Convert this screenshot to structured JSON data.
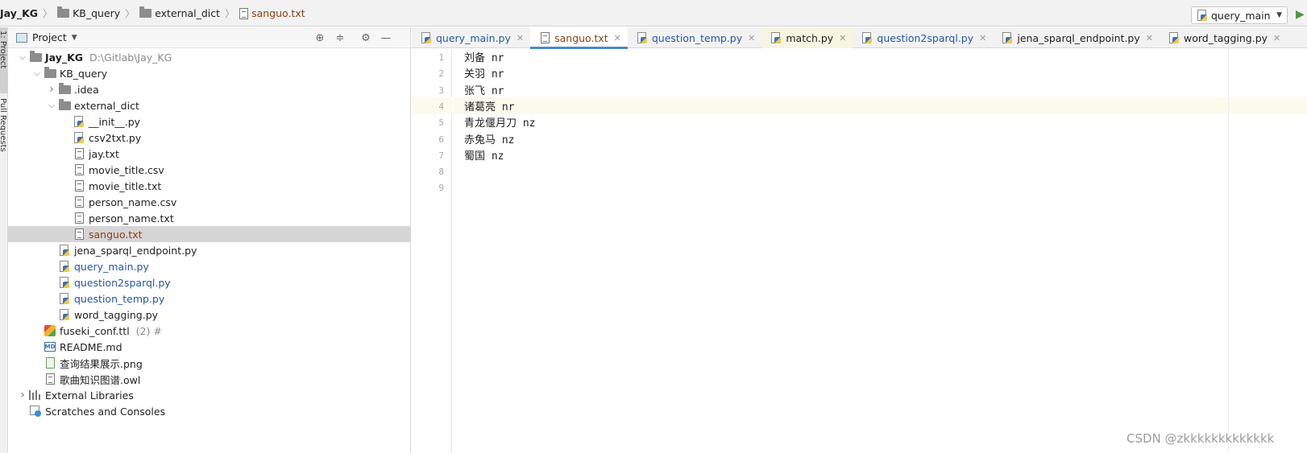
{
  "breadcrumb": [
    "Jay_KG",
    "KB_query",
    "external_dict",
    "sanguo.txt"
  ],
  "run_config": {
    "label": "query_main"
  },
  "side_strip": {
    "project_tab": "1: Project",
    "pull_requests_tab": "Pull Requests"
  },
  "project_panel": {
    "title": "Project",
    "tree": [
      {
        "name": "Jay_KG",
        "extra": "D:\\Gitlab\\Jay_KG",
        "level": 0,
        "arrow": "open",
        "icon": "folder-icon",
        "style": "bold"
      },
      {
        "name": "KB_query",
        "level": 1,
        "arrow": "open",
        "icon": "folder-icon",
        "style": ""
      },
      {
        "name": ".idea",
        "level": 2,
        "arrow": "closed",
        "icon": "folder-icon",
        "style": ""
      },
      {
        "name": "external_dict",
        "level": 2,
        "arrow": "open",
        "icon": "folder-icon",
        "style": ""
      },
      {
        "name": "__init__.py",
        "level": 3,
        "arrow": "none",
        "icon": "python-file-icon",
        "style": ""
      },
      {
        "name": "csv2txt.py",
        "level": 3,
        "arrow": "none",
        "icon": "python-file-icon",
        "style": ""
      },
      {
        "name": "jay.txt",
        "level": 3,
        "arrow": "none",
        "icon": "text-file-icon",
        "style": ""
      },
      {
        "name": "movie_title.csv",
        "level": 3,
        "arrow": "none",
        "icon": "text-file-icon",
        "style": ""
      },
      {
        "name": "movie_title.txt",
        "level": 3,
        "arrow": "none",
        "icon": "text-file-icon",
        "style": ""
      },
      {
        "name": "person_name.csv",
        "level": 3,
        "arrow": "none",
        "icon": "text-file-icon",
        "style": ""
      },
      {
        "name": "person_name.txt",
        "level": 3,
        "arrow": "none",
        "icon": "text-file-icon",
        "style": ""
      },
      {
        "name": "sanguo.txt",
        "level": 3,
        "arrow": "none",
        "icon": "text-file-icon",
        "style": "brown",
        "selected": true
      },
      {
        "name": "jena_sparql_endpoint.py",
        "level": 2,
        "arrow": "none",
        "icon": "python-file-icon",
        "style": ""
      },
      {
        "name": "query_main.py",
        "level": 2,
        "arrow": "none",
        "icon": "python-file-icon",
        "style": "blue"
      },
      {
        "name": "question2sparql.py",
        "level": 2,
        "arrow": "none",
        "icon": "python-file-icon",
        "style": "blue"
      },
      {
        "name": "question_temp.py",
        "level": 2,
        "arrow": "none",
        "icon": "python-file-icon",
        "style": "blue"
      },
      {
        "name": "word_tagging.py",
        "level": 2,
        "arrow": "none",
        "icon": "python-file-icon",
        "style": ""
      },
      {
        "name": "fuseki_conf.ttl",
        "extra": "(2) #",
        "level": 1,
        "arrow": "none",
        "icon": "ttl-file-icon",
        "style": ""
      },
      {
        "name": "README.md",
        "level": 1,
        "arrow": "none",
        "icon": "markdown-file-icon",
        "style": ""
      },
      {
        "name": "查询结果展示.png",
        "level": 1,
        "arrow": "none",
        "icon": "image-file-icon",
        "style": ""
      },
      {
        "name": "歌曲知识图谱.owl",
        "level": 1,
        "arrow": "none",
        "icon": "text-file-icon",
        "style": ""
      },
      {
        "name": "External Libraries",
        "level": 0,
        "arrow": "closed",
        "icon": "library-icon",
        "style": ""
      },
      {
        "name": "Scratches and Consoles",
        "level": 0,
        "arrow": "none",
        "icon": "scratches-icon",
        "style": ""
      }
    ]
  },
  "tabs": [
    {
      "label": "query_main.py",
      "style": "blue",
      "state": ""
    },
    {
      "label": "sanguo.txt",
      "style": "brown",
      "state": "active"
    },
    {
      "label": "question_temp.py",
      "style": "blue",
      "state": ""
    },
    {
      "label": "match.py",
      "style": "dark",
      "state": "modified"
    },
    {
      "label": "question2sparql.py",
      "style": "blue",
      "state": ""
    },
    {
      "label": "jena_sparql_endpoint.py",
      "style": "dark",
      "state": ""
    },
    {
      "label": "word_tagging.py",
      "style": "dark",
      "state": ""
    }
  ],
  "editor": {
    "current_line": 4,
    "lines": [
      "刘备 nr",
      "关羽 nr",
      "张飞 nr",
      "诸葛亮 nr",
      "青龙偃月刀 nz",
      "赤兔马 nz",
      "蜀国 nz",
      "",
      ""
    ]
  },
  "watermark": "CSDN @zkkkkkkkkkkkkk"
}
